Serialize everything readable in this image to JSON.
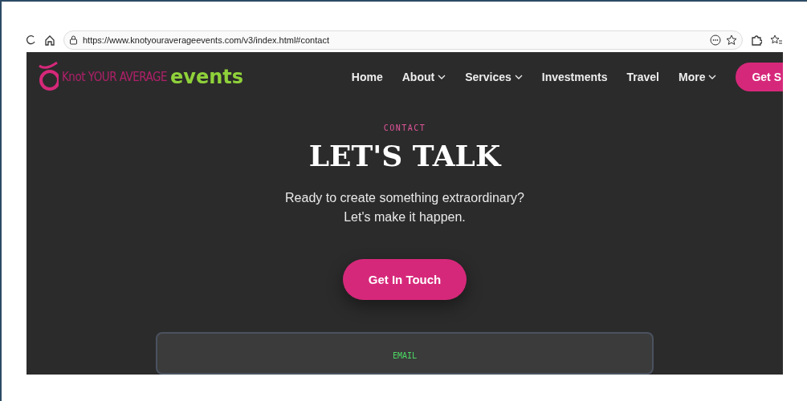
{
  "browser": {
    "url": "https://www.knotyouraverageevents.com/v3/index.html#contact"
  },
  "logo": {
    "part_1": "Knot YOUR AVERAGE",
    "part_2": "events"
  },
  "nav": [
    {
      "label": "Home",
      "dropdown": false
    },
    {
      "label": "About",
      "dropdown": true
    },
    {
      "label": "Services",
      "dropdown": true
    },
    {
      "label": "Investments",
      "dropdown": false
    },
    {
      "label": "Travel",
      "dropdown": false
    },
    {
      "label": "More",
      "dropdown": true
    }
  ],
  "nav_button": "Get S",
  "hero": {
    "eyebrow": "CONTACT",
    "title": "LET'S TALK",
    "lines": [
      "Ready to create something extraordinary?",
      "Let's make it happen."
    ],
    "button": "Get In Touch"
  },
  "card": {
    "label": "EMAIL"
  }
}
